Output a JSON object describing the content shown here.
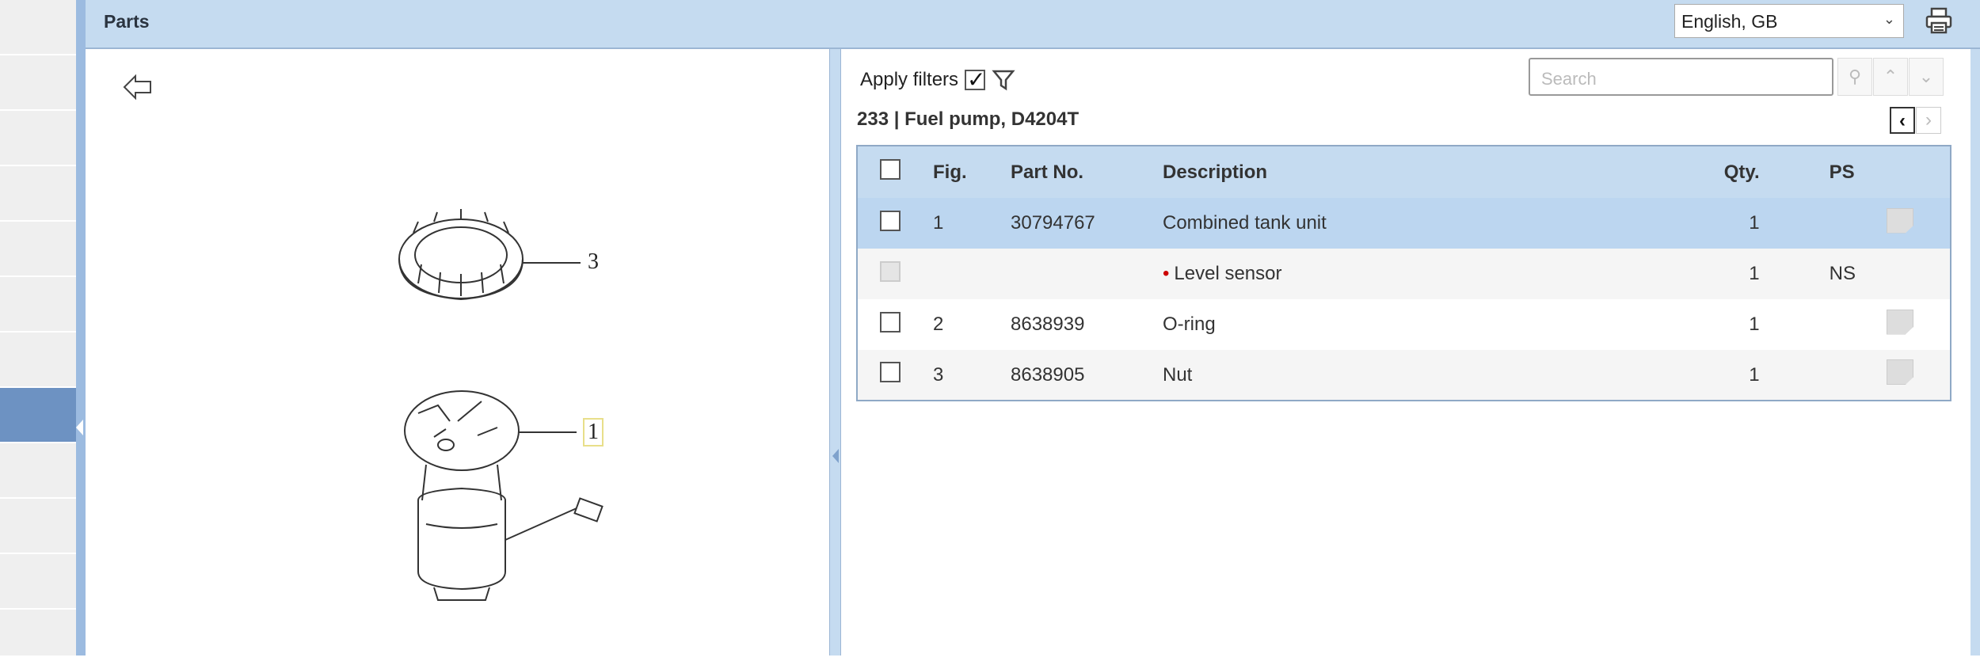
{
  "header": {
    "title": "Parts",
    "language": "English, GB"
  },
  "filters": {
    "label": "Apply filters",
    "checked": true
  },
  "search": {
    "placeholder": "Search"
  },
  "breadcrumb": "233  |  Fuel pump, D4204T",
  "pager": {
    "prev": "‹",
    "next": "›"
  },
  "table": {
    "columns": [
      "Fig.",
      "Part No.",
      "Description",
      "Qty.",
      "PS"
    ],
    "rows": [
      {
        "fig": "1",
        "part_no": "30794767",
        "description": "Combined tank unit",
        "qty": "1",
        "ps": ""
      },
      {
        "fig": "",
        "part_no": "",
        "description": "Level sensor",
        "qty": "1",
        "ps": "NS"
      },
      {
        "fig": "2",
        "part_no": "8638939",
        "description": "O-ring",
        "qty": "1",
        "ps": ""
      },
      {
        "fig": "3",
        "part_no": "8638905",
        "description": "Nut",
        "qty": "1",
        "ps": ""
      }
    ]
  },
  "diagram": {
    "callouts": [
      "3",
      "1"
    ]
  },
  "colors": {
    "header": "#c5dbf0",
    "selected_row": "#bcd6f0",
    "sidebar_selected": "#6d92c2"
  }
}
